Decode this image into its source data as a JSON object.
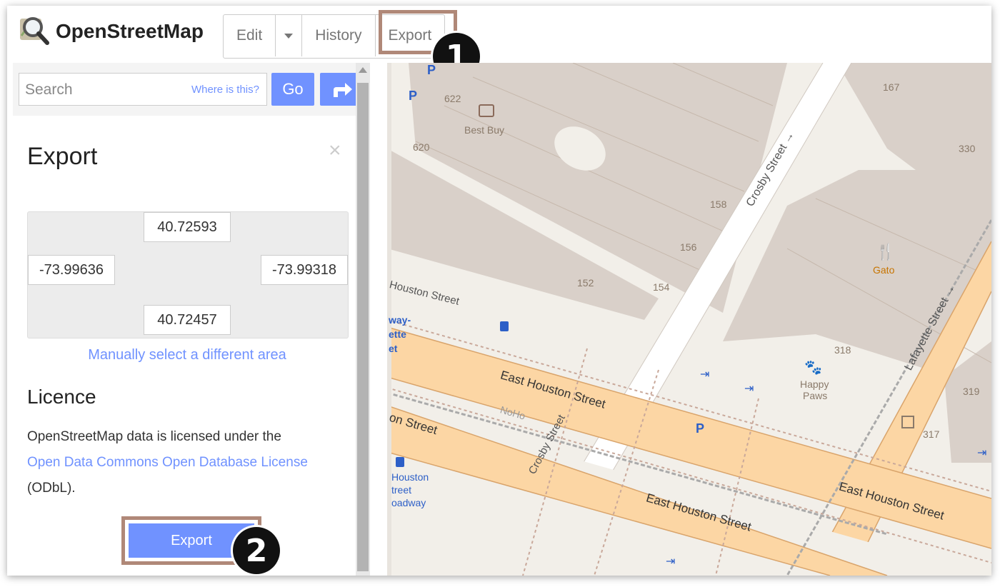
{
  "header": {
    "brand": "OpenStreetMap",
    "tabs": {
      "edit": "Edit",
      "history": "History",
      "export": "Export"
    },
    "step_badge": "1"
  },
  "search": {
    "placeholder": "Search",
    "where_link": "Where is this?",
    "go_label": "Go"
  },
  "export_panel": {
    "title": "Export",
    "close": "×",
    "bbox": {
      "north": "40.72593",
      "west": "-73.99636",
      "east": "-73.99318",
      "south": "40.72457"
    },
    "manual_link": "Manually select a different area",
    "licence_title": "Licence",
    "licence_text_1": "OpenStreetMap data is licensed under the",
    "licence_link": "Open Data Commons Open Database License",
    "licence_text_2": "(ODbL).",
    "export_button": "Export",
    "step_badge": "2"
  },
  "map": {
    "streets": {
      "crosby_1": "Crosby Street →",
      "crosby_2": "Crosby Street",
      "lafayette": "Lafayette Street →",
      "ehouston_1": "East Houston Street",
      "ehouston_2": "East Houston Street",
      "ehouston_3": "East Houston Street",
      "houston_w1": "Houston Street",
      "houston_w2": "on Street",
      "noho": "NoHo"
    },
    "pois": {
      "best_buy": "Best Buy",
      "gato": "Gato",
      "happy_paws_1": "Happy",
      "happy_paws_2": "Paws",
      "subway_1": "way-",
      "subway_2": "ette",
      "subway_3": "et",
      "bus_1": "Houston",
      "bus_2": "treet",
      "bus_3": "oadway"
    },
    "house_numbers": [
      "622",
      "620",
      "167",
      "330",
      "158",
      "156",
      "152",
      "154",
      "318",
      "319",
      "317"
    ]
  },
  "colors": {
    "accent": "#7092ff",
    "highlight": "#b08878",
    "road_major": "#fcd6a4",
    "building": "#d9d0c9"
  }
}
